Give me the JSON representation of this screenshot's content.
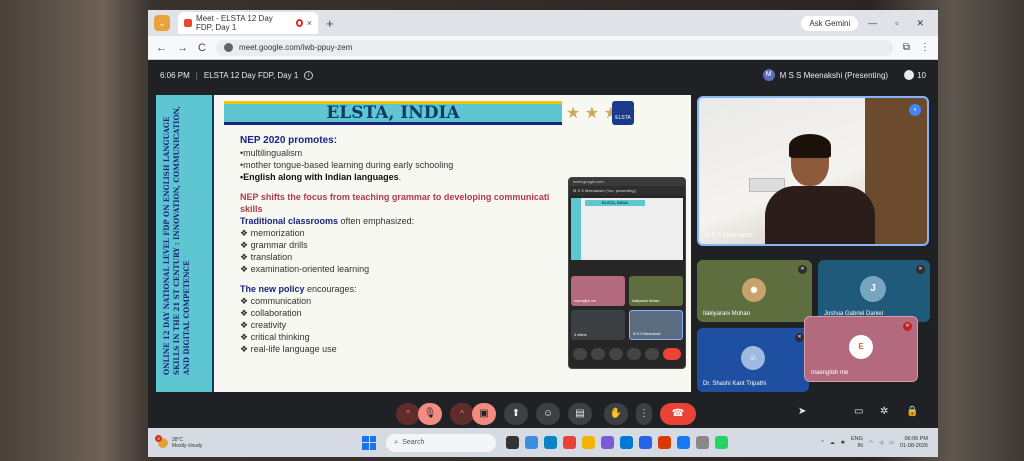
{
  "browser": {
    "tab_title": "Meet - ELSTA 12 Day FDP, Day 1",
    "tab_close": "×",
    "new_tab": "+",
    "ask_gemini": "Ask Gemini",
    "url": "meet.google.com/iwb-ppuy-zem",
    "back": "←",
    "forward": "→",
    "reload": "C"
  },
  "meeting": {
    "time": "6:06 PM",
    "separator": "|",
    "title": "ELSTA 12 Day FDP, Day 1",
    "presenter_initial": "M",
    "presenter_label": "M S S Meenakshi (Presenting)",
    "participant_count": "10"
  },
  "slide": {
    "side_text": "ONLINE 12 DAY NATIONAL LEVEL FDP ON ENGLISH LANGUAGE SKILLS IN THE 21 ST CENTURY : INNOVATION, COMMUNICATION, AND DIGITAL COMPETENCE",
    "title": "ELSTA, INDIA",
    "stars": "★ ★ ★ ★",
    "logo_text": "ELSTA",
    "heading1": "NEP 2020 promotes:",
    "promotes": [
      "•multilingualism",
      "•mother tongue-based learning during early schooling"
    ],
    "promotes_bold": "•English along with Indian languages",
    "promotes_bold_tail": ".",
    "shift_heading": "NEP shifts the focus from teaching grammar to developing communicati",
    "shift_heading2": "skills",
    "traditional_label": "Traditional classrooms",
    "traditional_tail": " often emphasized:",
    "traditional_items": [
      "❖ memorization",
      "❖ grammar drills",
      "❖ translation",
      "❖ examination-oriented learning"
    ],
    "policy_label": "The new policy",
    "policy_tail": " encourages:",
    "policy_items": [
      "❖ communication",
      "❖ collaboration",
      "❖ creativity",
      "❖ critical thinking",
      "❖ real-life language use"
    ]
  },
  "mini_screen": {
    "url": "meet.google.com",
    "presenter": "M S S Meenakshi (You, presenting)",
    "slide_title": "ELSTA, INDIA",
    "tile1": "maenglish me",
    "tile2": "Ilakiyarani Mohan",
    "tile3": "4 others",
    "tile4": "M S S Meenakshi"
  },
  "participants": {
    "meenakshi": "M S S Meenakshi",
    "ilakiyarani": "Ilakiyarani Mohan",
    "joshua": "Joshua Gabriel Daniel",
    "joshua_initial": "J",
    "shashi": "Dr. Shashi Kant Tripathi",
    "maenglish": "maenglish me",
    "maenglish_initial": "E"
  },
  "controls": {
    "up": "^",
    "mic_off": "🎙",
    "cam_off": "▣",
    "present": "⬆",
    "emoji": "☺",
    "captions": "▤",
    "raise_hand": "✋",
    "more": "⋮",
    "end_call": "☎",
    "chat": "▭",
    "activities": "✲",
    "host": "🔒"
  },
  "taskbar": {
    "temperature": "28°C",
    "weather": "Mostly cloudy",
    "weather_badge": "3",
    "search": "Search",
    "lang": "ENG",
    "region": "IN",
    "time": "06:06 PM",
    "date": "01-08-2026"
  }
}
